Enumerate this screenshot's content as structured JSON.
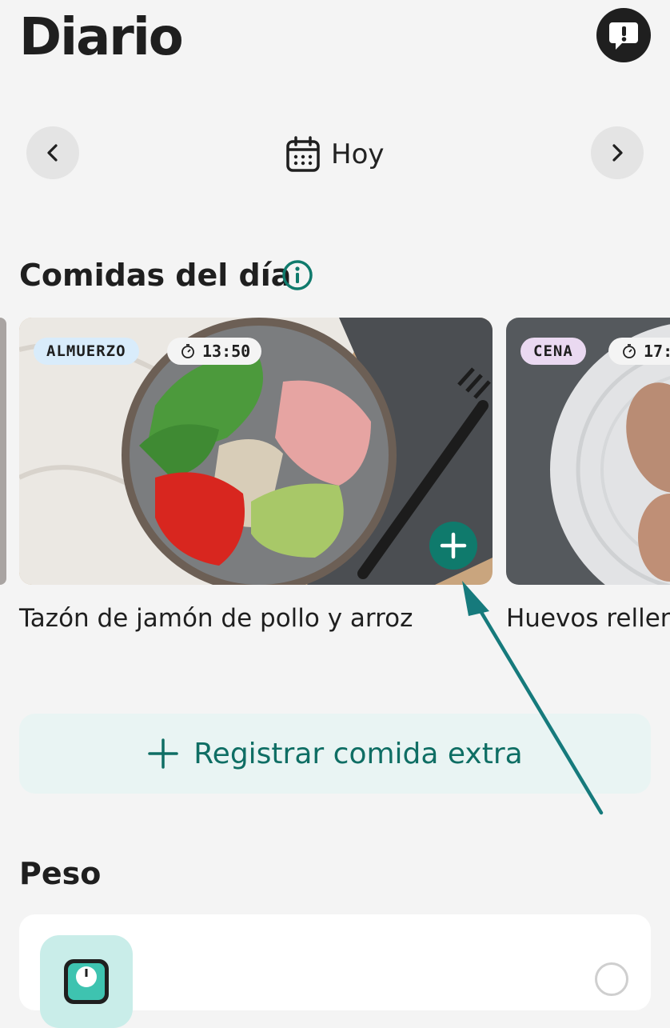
{
  "header": {
    "title": "Diario"
  },
  "date_nav": {
    "label": "Hoy"
  },
  "meals_section": {
    "title": "Comidas del día"
  },
  "meals": [
    {
      "type_label": "ALMUERZO",
      "time": "13:50",
      "name": "Tazón de jamón de pollo y arroz",
      "badge_color": "#d9ecfb"
    },
    {
      "type_label": "CENA",
      "time": "17:",
      "name": "Huevos rellen",
      "badge_color": "#ead9f1"
    }
  ],
  "extra_meal": {
    "label": "Registrar comida extra"
  },
  "weight_section": {
    "title": "Peso"
  },
  "colors": {
    "accent": "#0f7a6c",
    "background": "#f4f4f4",
    "annotation_arrow": "#167a7c"
  }
}
